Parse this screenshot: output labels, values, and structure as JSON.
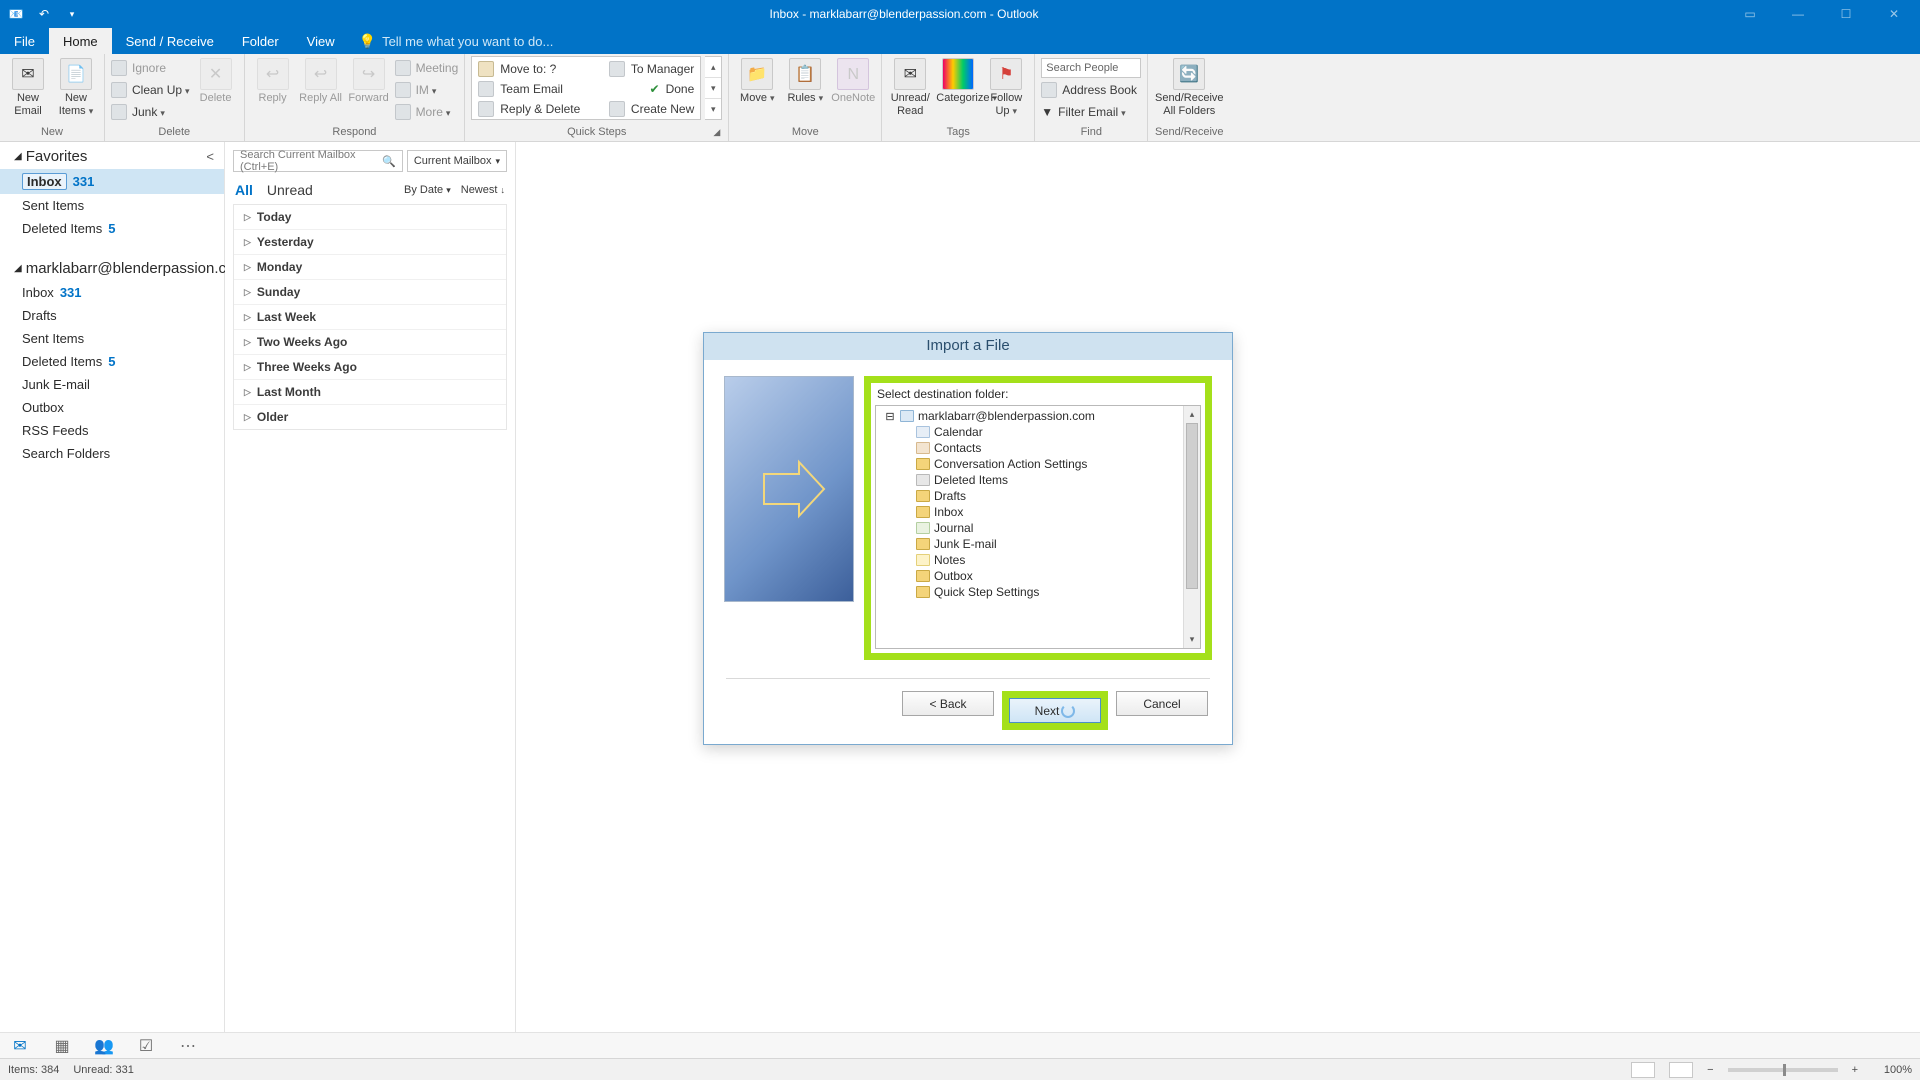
{
  "titlebar": {
    "title": "Inbox - marklabarr@blenderpassion.com - Outlook"
  },
  "tabs": {
    "file": "File",
    "home": "Home",
    "sendreceive": "Send / Receive",
    "folder": "Folder",
    "view": "View",
    "tellme": "Tell me what you want to do..."
  },
  "ribbon": {
    "new": {
      "email": "New Email",
      "items": "New Items",
      "group": "New"
    },
    "delete": {
      "ignore": "Ignore",
      "cleanup": "Clean Up",
      "junk": "Junk",
      "delete": "Delete",
      "group": "Delete"
    },
    "respond": {
      "reply": "Reply",
      "replyall": "Reply All",
      "forward": "Forward",
      "meeting": "Meeting",
      "im": "IM",
      "more": "More",
      "group": "Respond"
    },
    "quicksteps": {
      "moveto": "Move to: ?",
      "teamemail": "Team Email",
      "replydelete": "Reply & Delete",
      "tomanager": "To Manager",
      "done": "Done",
      "createnew": "Create New",
      "group": "Quick Steps"
    },
    "move": {
      "move": "Move",
      "rules": "Rules",
      "onenote": "OneNote",
      "group": "Move"
    },
    "tags": {
      "unread": "Unread/ Read",
      "categorize": "Categorize",
      "followup": "Follow Up",
      "group": "Tags"
    },
    "find": {
      "search_placeholder": "Search People",
      "addressbook": "Address Book",
      "filteremail": "Filter Email",
      "group": "Find"
    },
    "sendreceive": {
      "btn": "Send/Receive All Folders",
      "group": "Send/Receive"
    }
  },
  "nav": {
    "favorites": "Favorites",
    "fav": [
      {
        "name": "Inbox",
        "count": "331"
      },
      {
        "name": "Sent Items",
        "count": ""
      },
      {
        "name": "Deleted Items",
        "count": "5"
      }
    ],
    "account": "marklabarr@blenderpassion.co...",
    "folders": [
      {
        "name": "Inbox",
        "count": "331"
      },
      {
        "name": "Drafts",
        "count": ""
      },
      {
        "name": "Sent Items",
        "count": ""
      },
      {
        "name": "Deleted Items",
        "count": "5"
      },
      {
        "name": "Junk E-mail",
        "count": ""
      },
      {
        "name": "Outbox",
        "count": ""
      },
      {
        "name": "RSS Feeds",
        "count": ""
      },
      {
        "name": "Search Folders",
        "count": ""
      }
    ]
  },
  "mlist": {
    "search_placeholder": "Search Current Mailbox (Ctrl+E)",
    "scope": "Current Mailbox",
    "all": "All",
    "unread": "Unread",
    "sortby": "By Date",
    "sortdir": "Newest",
    "groups": [
      "Today",
      "Yesterday",
      "Monday",
      "Sunday",
      "Last Week",
      "Two Weeks Ago",
      "Three Weeks Ago",
      "Last Month",
      "Older"
    ]
  },
  "dialog": {
    "title": "Import a File",
    "select_label": "Select destination folder:",
    "root": "marklabarr@blenderpassion.com",
    "folders": [
      "Calendar",
      "Contacts",
      "Conversation Action Settings",
      "Deleted Items",
      "Drafts",
      "Inbox",
      "Journal",
      "Junk E-mail",
      "Notes",
      "Outbox",
      "Quick Step Settings"
    ],
    "back": "< Back",
    "next": "Next",
    "cancel": "Cancel"
  },
  "status": {
    "items": "Items: 384",
    "unread": "Unread: 331",
    "zoom": "100%"
  }
}
